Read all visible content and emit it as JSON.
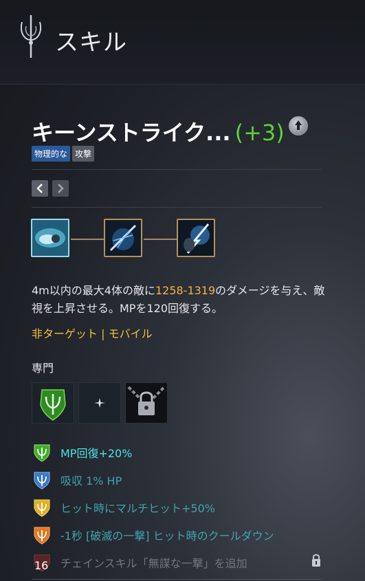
{
  "header": {
    "title": "スキル"
  },
  "skill": {
    "name": "キーンストライク...",
    "level": "(+3)",
    "tags": [
      "物理的な",
      "攻撃"
    ]
  },
  "description": {
    "part1": "4m以内の最大4体の敵に",
    "damage": "1258-1319",
    "part2": "のダメージを与え、敵視を上昇させる。MPを120回復する。"
  },
  "targeting": "非ターゲット | モバイル",
  "specialization": {
    "label": "専門",
    "bonuses": [
      {
        "text": "MP回復+20%",
        "color": "#4fe0e8",
        "icon_color": "#3fae2a"
      },
      {
        "text": "吸収 1% HP",
        "color": "#3fa3b0",
        "icon_color": "#3a78c8"
      },
      {
        "text": "ヒット時にマルチヒット+50%",
        "color": "#3fa3b0",
        "icon_color": "#e2b020"
      },
      {
        "text": "-1秒 [破滅の一撃] ヒット時のクールダウン",
        "color": "#3fa3b0",
        "icon_color": "#e07820"
      },
      {
        "text": "チェインスキル「無謀な一撃」を追加",
        "color": "#707680",
        "icon_color": "#7a2a2a",
        "level": "16",
        "locked": true
      }
    ]
  },
  "icons": {
    "header": "trident-emblem-icon",
    "upgrade": "arrow-up-icon",
    "nav_prev": "chevron-left-icon",
    "nav_next": "chevron-right-icon",
    "spec_slot_1": "trident-shield-icon",
    "spec_slot_2": "sparkle-icon",
    "spec_slot_3": "padlock-chain-icon",
    "lock": "lock-icon"
  }
}
